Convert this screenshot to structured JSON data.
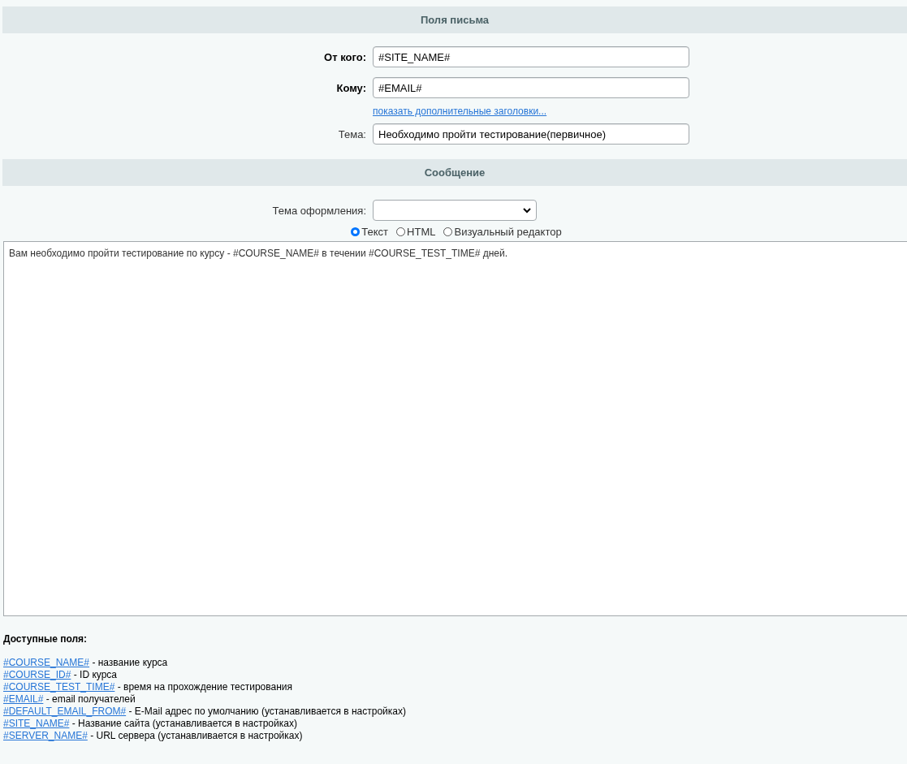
{
  "sections": [
    {
      "title": "Поля письма"
    },
    {
      "title": "Сообщение"
    }
  ],
  "fields": [
    {
      "label": "От кого:",
      "required": true,
      "value": "#SITE_NAME#"
    },
    {
      "label": "Кому:",
      "required": true,
      "value": "#EMAIL#"
    },
    {
      "label": "Тема:",
      "required": false,
      "value": "Необходимо пройти тестирование(первичное)"
    }
  ],
  "extra_headers_link": "показать дополнительные заголовки...",
  "theme": {
    "label": "Тема оформления:"
  },
  "formats": [
    {
      "label": "Текст",
      "selected": true
    },
    {
      "label": "HTML",
      "selected": false
    },
    {
      "label": "Визуальный редактор",
      "selected": false
    }
  ],
  "message": "Вам необходимо пройти тестирование по курсу - #COURSE_NAME# в течении #COURSE_TEST_TIME# дней.",
  "available": {
    "title": "Доступные поля:",
    "items": [
      {
        "token": "#COURSE_NAME#",
        "description": "- название курса"
      },
      {
        "token": "#COURSE_ID#",
        "description": "- ID курса"
      },
      {
        "token": "#COURSE_TEST_TIME#",
        "description": "- время на прохождение тестирования"
      },
      {
        "token": "#EMAIL#",
        "description": "- email получателей"
      },
      {
        "token": "#DEFAULT_EMAIL_FROM#",
        "description": "- E-Mail адрес по умолчанию (устанавливается в настройках)"
      },
      {
        "token": "#SITE_NAME#",
        "description": "- Название сайта (устанавливается в настройках)"
      },
      {
        "token": "#SERVER_NAME#",
        "description": "- URL сервера (устанавливается в настройках)"
      }
    ]
  }
}
